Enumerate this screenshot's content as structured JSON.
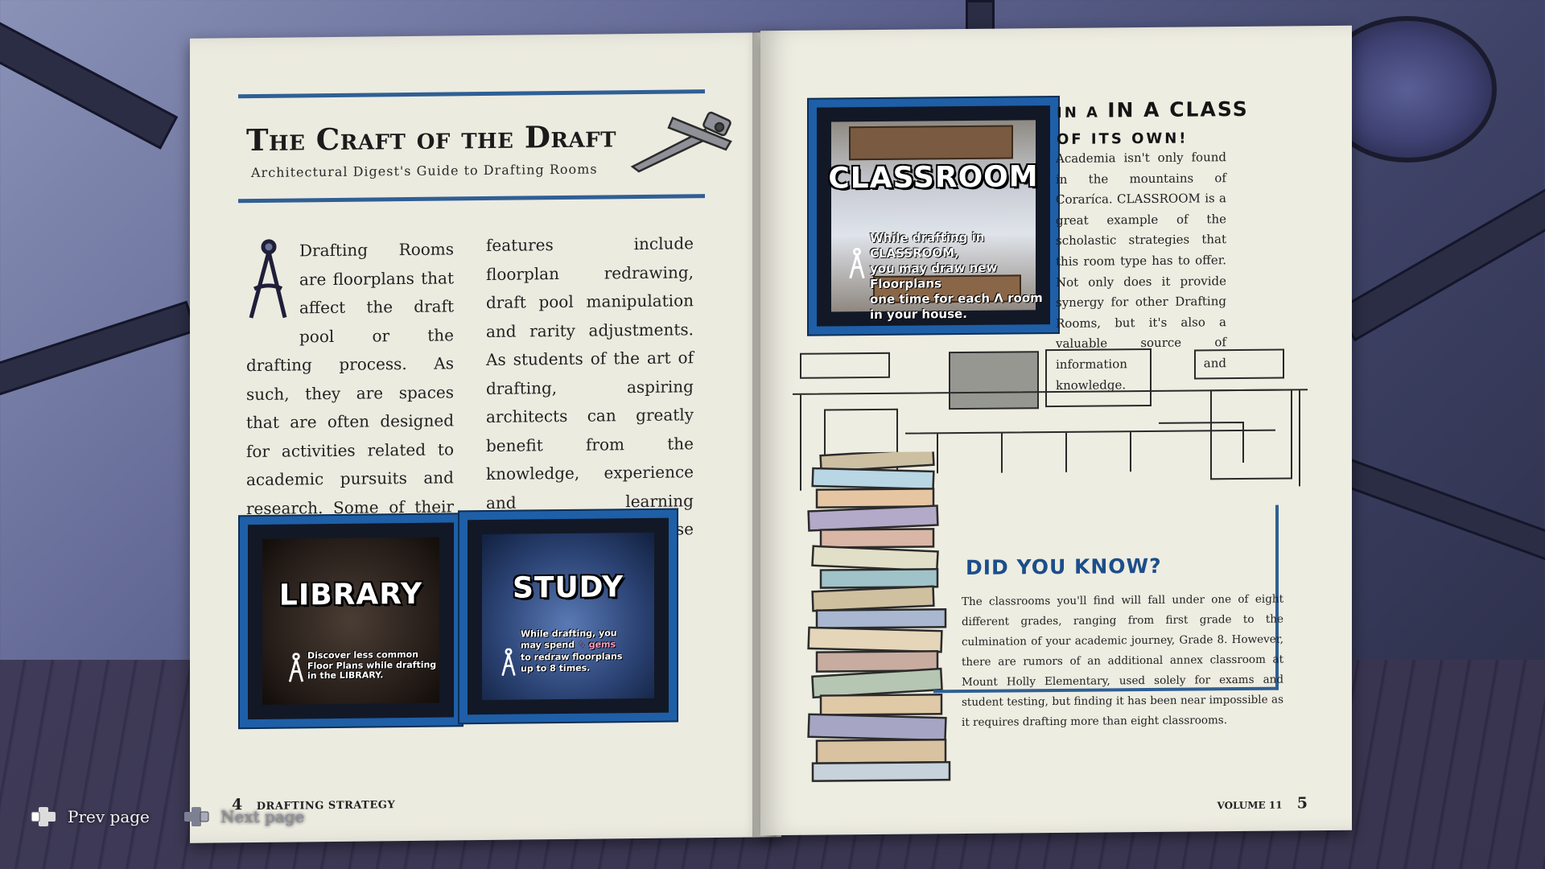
{
  "left_page": {
    "title": "The Craft of the Draft",
    "subtitle": "Architectural Digest's Guide to Drafting Rooms",
    "col1": "Drafting Rooms are floorplans that affect the draft pool or the drafting process. As such, they are spaces that are often designed for activities related to academic pursuits and research. Some of their common",
    "col2": "features include floorplan redrawing, draft pool manipulation and rarity adjustments. As students of the art of drafting, aspiring architects can greatly benefit from the knowledge, experience and learning opportunities that these rooms offer.",
    "library": {
      "title": "LIBRARY",
      "desc_1": "Discover less common",
      "desc_2": "Floor Plans while drafting",
      "desc_3": "in the LIBRARY."
    },
    "study": {
      "title": "STUDY",
      "desc_1": "While drafting, you",
      "desc_2": "may spend",
      "gems": "gems",
      "desc_3": "to redraw floorplans",
      "desc_4": "up to 8 times."
    },
    "page_number": "4",
    "section": "DRAFTING STRATEGY"
  },
  "right_page": {
    "heading_1": "IN A CLASS",
    "heading_2": "OF ITS OWN!",
    "body": "Academia isn't only found in the mountains of Coraríca. CLASSROOM is a great example of the scholastic strategies that this room type has to offer. Not only does it provide synergy for other Drafting Rooms, but it's also a valuable source of information and knowledge.",
    "classroom": {
      "title": "CLASSROOM",
      "desc_1": "While drafting in CLASSROOM,",
      "desc_2": "you may draw new Floorplans",
      "desc_3": "one time for each",
      "desc_4": "room",
      "desc_5": "in your house."
    },
    "did_you_know_title": "DID YOU KNOW?",
    "did_you_know_body": "The classrooms you'll find will fall under one of eight different grades, ranging from first grade to the culmination of your academic journey, Grade 8. However, there are rumors of an additional annex classroom at Mount Holly Elementary, used solely for exams and student testing, but finding it has been near impossible as it requires drafting more than eight classrooms.",
    "volume": "VOLUME 11",
    "page_number": "5"
  },
  "controls": {
    "prev_label": "Prev page",
    "next_label": "Next page"
  },
  "colors": {
    "accent_blue": "#1e5fa8",
    "rule_blue": "#2f5f94",
    "paper": "#ecebe0"
  },
  "icons": [
    "drafting-compass-icon",
    "dpad-left-icon",
    "dpad-right-icon",
    "gem-icon",
    "stack-of-books",
    "classroom-sketch"
  ]
}
